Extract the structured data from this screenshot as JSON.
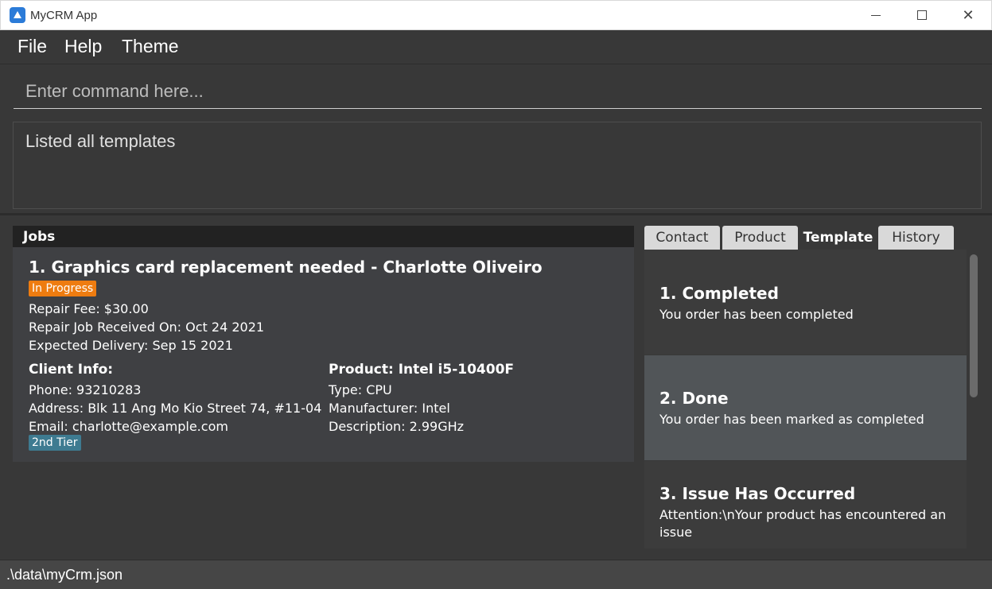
{
  "window": {
    "title": "MyCRM App",
    "icons": {
      "app": "mycrm-logo-icon",
      "minimize": "minimize-icon",
      "maximize": "maximize-icon",
      "close": "close-icon"
    }
  },
  "menu": {
    "items": [
      {
        "label": "File"
      },
      {
        "label": "Help"
      },
      {
        "label": "Theme"
      }
    ]
  },
  "command": {
    "placeholder": "Enter command here...",
    "value": ""
  },
  "result": {
    "message": "Listed all templates"
  },
  "jobs": {
    "header": "Jobs",
    "items": [
      {
        "title": "1. Graphics card replacement needed - Charlotte Oliveiro",
        "status": "In Progress",
        "repair_fee": "Repair Fee: $30.00",
        "received_on": "Repair Job Received On: Oct 24 2021",
        "expected_delivery": "Expected Delivery: Sep 15 2021",
        "client": {
          "heading": "Client Info:",
          "phone": "Phone: 93210283",
          "address": "Address: Blk 11 Ang Mo Kio Street 74, #11-04",
          "email": "Email: charlotte@example.com",
          "tier": "2nd Tier"
        },
        "product": {
          "heading": "Product: Intel i5-10400F",
          "type": "Type: CPU",
          "manufacturer": "Manufacturer: Intel",
          "description": "Description: 2.99GHz"
        }
      }
    ]
  },
  "tabs": {
    "items": [
      {
        "label": "Contact"
      },
      {
        "label": "Product"
      },
      {
        "label": "Template"
      },
      {
        "label": "History"
      }
    ],
    "selected": "Template"
  },
  "templates": {
    "items": [
      {
        "title": "1.  Completed",
        "body": "You order has been completed"
      },
      {
        "title": "2.  Done",
        "body": "You order has been marked as completed"
      },
      {
        "title": "3.  Issue Has Occurred",
        "body": "Attention:\\nYour product has encountered an issue"
      }
    ]
  },
  "status_bar": {
    "path": ".\\data\\myCrm.json"
  },
  "colors": {
    "background": "#383838",
    "status_in_progress": "#ee7c10",
    "tier_badge": "#3e7b91",
    "selected_template_row": "#515558"
  }
}
